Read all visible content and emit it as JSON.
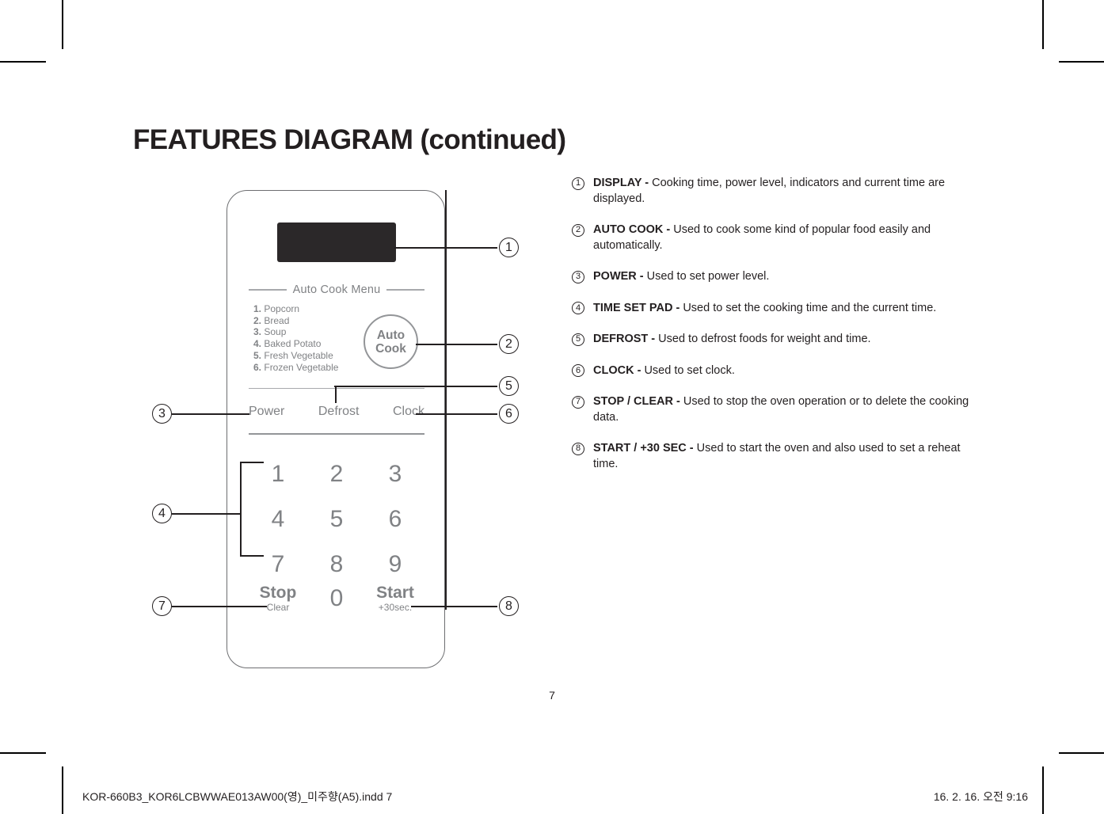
{
  "document": {
    "title": "FEATURES DIAGRAM (continued)",
    "page_number": "7",
    "footer_left": "KOR-660B3_KOR6LCBWWAE013AW00(영)_미주향(A5).indd   7",
    "footer_right": "16. 2. 16.   오전 9:16"
  },
  "colors": {
    "text": "#231f20",
    "panel_outline": "#6d6e71",
    "panel_label": "#808285",
    "display_screen": "#2b2829",
    "rule_light": "#a7a9ac",
    "rule_dark": "#939598"
  },
  "control_panel": {
    "display_label": "",
    "auto_cook_menu_title": "Auto Cook Menu",
    "auto_cook_menu_items": [
      {
        "num": "1.",
        "label": "Popcorn"
      },
      {
        "num": "2.",
        "label": "Bread"
      },
      {
        "num": "3.",
        "label": "Soup"
      },
      {
        "num": "4.",
        "label": "Baked Potato"
      },
      {
        "num": "5.",
        "label": "Fresh Vegetable"
      },
      {
        "num": "6.",
        "label": "Frozen Vegetable"
      }
    ],
    "auto_cook_button": {
      "line1": "Auto",
      "line2": "Cook"
    },
    "function_row": [
      "Power",
      "Defrost",
      "Clock"
    ],
    "keypad": [
      "1",
      "2",
      "3",
      "4",
      "5",
      "6",
      "7",
      "8",
      "9"
    ],
    "bottom_row": {
      "stop_main": "Stop",
      "stop_sub": "Clear",
      "zero": "0",
      "start_main": "Start",
      "start_sub": "+30sec."
    }
  },
  "callouts": [
    "1",
    "2",
    "3",
    "4",
    "5",
    "6",
    "7",
    "8"
  ],
  "features": [
    {
      "num": "1",
      "term": "DISPLAY - ",
      "desc": "Cooking time, power level, indicators and current time are displayed."
    },
    {
      "num": "2",
      "term": "AUTO COOK - ",
      "desc": "Used to cook some kind of popular food easily and automatically."
    },
    {
      "num": "3",
      "term": "POWER - ",
      "desc": "Used to set power level."
    },
    {
      "num": "4",
      "term": "TIME SET PAD - ",
      "desc": "Used to set the cooking time and the current time."
    },
    {
      "num": "5",
      "term": "DEFROST - ",
      "desc": "Used to defrost foods for weight and time."
    },
    {
      "num": "6",
      "term": "CLOCK - ",
      "desc": "Used to set clock."
    },
    {
      "num": "7",
      "term": "STOP / CLEAR - ",
      "desc": "Used to stop the oven operation or to delete the cooking data."
    },
    {
      "num": "8",
      "term": "START / +30 SEC - ",
      "desc": "Used to start the oven and also used to set a reheat time."
    }
  ]
}
